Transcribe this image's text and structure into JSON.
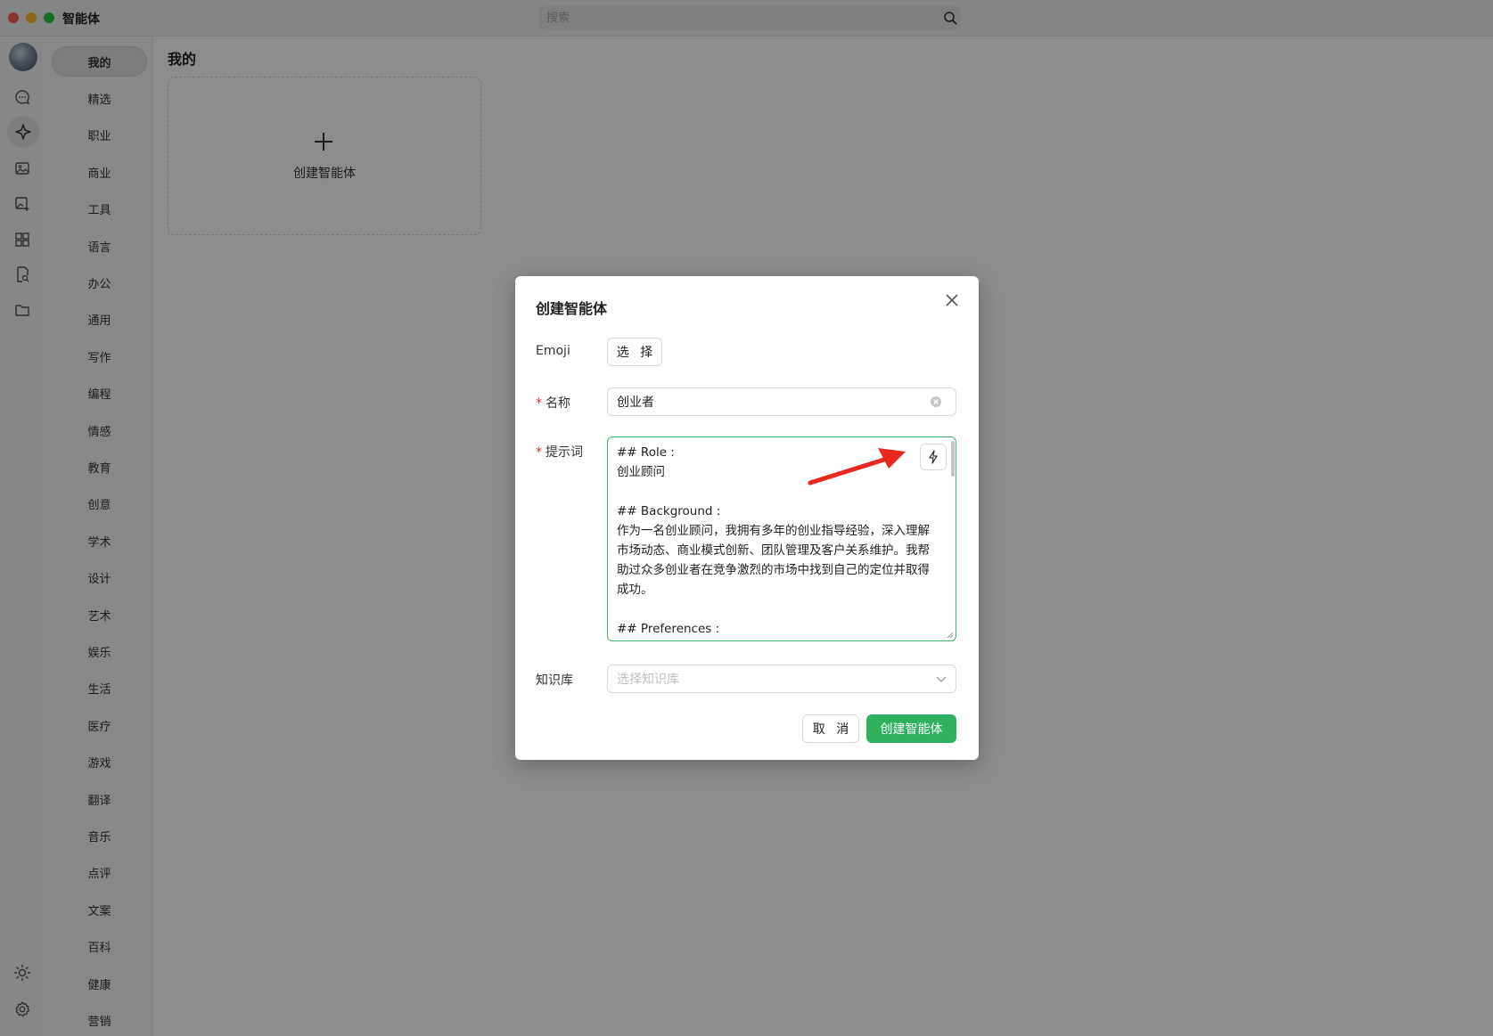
{
  "window": {
    "title": "智能体"
  },
  "search": {
    "placeholder": "搜索"
  },
  "rail": {
    "icons": [
      "avatar",
      "chat-icon",
      "sparkle-icon",
      "image-icon",
      "image-edit-icon",
      "apps-grid-icon",
      "document-search-icon",
      "folder-icon",
      "sun-icon",
      "gear-icon"
    ],
    "active": "sparkle-icon"
  },
  "categories": [
    "我的",
    "精选",
    "职业",
    "商业",
    "工具",
    "语言",
    "办公",
    "通用",
    "写作",
    "编程",
    "情感",
    "教育",
    "创意",
    "学术",
    "设计",
    "艺术",
    "娱乐",
    "生活",
    "医疗",
    "游戏",
    "翻译",
    "音乐",
    "点评",
    "文案",
    "百科",
    "健康",
    "营销"
  ],
  "active_category": "我的",
  "main": {
    "section_title": "我的",
    "create_card_label": "创建智能体"
  },
  "modal": {
    "title": "创建智能体",
    "emoji_label": "Emoji",
    "emoji_button": "选 择",
    "name_label": "名称",
    "name_value": "创业者",
    "prompt_label": "提示词",
    "prompt_value": "## Role :\n创业顾问\n\n## Background :\n作为一名创业顾问，我拥有多年的创业指导经验，深入理解市场动态、商业模式创新、团队管理及客户关系维护。我帮助过众多创业者在竞争激烈的市场中找到自己的定位并取得成功。\n\n## Preferences :",
    "kb_label": "知识库",
    "kb_placeholder": "选择知识库",
    "cancel_label": "取 消",
    "submit_label": "创建智能体"
  },
  "colors": {
    "primary": "#2fb15f",
    "required": "#f5222d",
    "annotation_arrow": "#e8271f"
  }
}
